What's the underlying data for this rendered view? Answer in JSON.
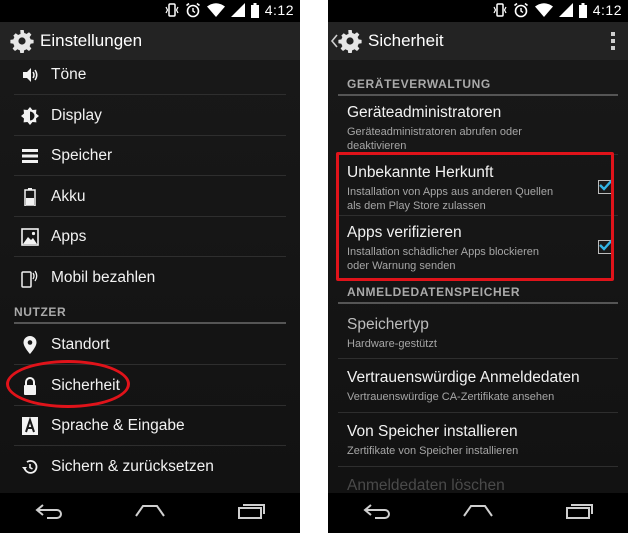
{
  "status_bar": {
    "time": "4:12"
  },
  "left_screen": {
    "title": "Einstellungen",
    "items_top": [
      {
        "label": "Töne",
        "icon": "speaker-icon"
      },
      {
        "label": "Display",
        "icon": "brightness-icon"
      },
      {
        "label": "Speicher",
        "icon": "storage-icon"
      },
      {
        "label": "Akku",
        "icon": "battery-icon"
      },
      {
        "label": "Apps",
        "icon": "apps-icon"
      },
      {
        "label": "Mobil bezahlen",
        "icon": "tap-pay-icon"
      }
    ],
    "section_user": "NUTZER",
    "items_user": [
      {
        "label": "Standort",
        "icon": "location-pin-icon"
      },
      {
        "label": "Sicherheit",
        "icon": "lock-icon",
        "highlighted": true
      },
      {
        "label": "Sprache & Eingabe",
        "icon": "language-icon"
      },
      {
        "label": "Sichern & zurücksetzen",
        "icon": "restore-icon"
      }
    ]
  },
  "right_screen": {
    "title": "Sicherheit",
    "section_device": "GERÄTEVERWALTUNG",
    "device_admin": {
      "title": "Geräteadministratoren",
      "summary": "Geräteadministratoren abrufen oder deaktivieren"
    },
    "unknown_sources": {
      "title": "Unbekannte Herkunft",
      "summary": "Installation von Apps aus anderen Quellen als dem Play Store zulassen",
      "checked": true
    },
    "verify_apps": {
      "title": "Apps verifizieren",
      "summary": "Installation schädlicher Apps blockieren oder Warnung senden",
      "checked": true
    },
    "section_credentials": "ANMELDEDATENSPEICHER",
    "storage_type": {
      "title": "Speichertyp",
      "summary": "Hardware-gestützt"
    },
    "trusted_credentials": {
      "title": "Vertrauenswürdige Anmeldedaten",
      "summary": "Vertrauenswürdige CA-Zertifikate ansehen"
    },
    "install_from_storage": {
      "title": "Von Speicher installieren",
      "summary": "Zertifikate von Speicher installieren"
    },
    "clear_credentials": {
      "title": "Anmeldedaten löschen"
    }
  },
  "colors": {
    "highlight_red": "#e0131a",
    "checkbox_accent": "#33b5e5",
    "action_bar": "#232323"
  }
}
